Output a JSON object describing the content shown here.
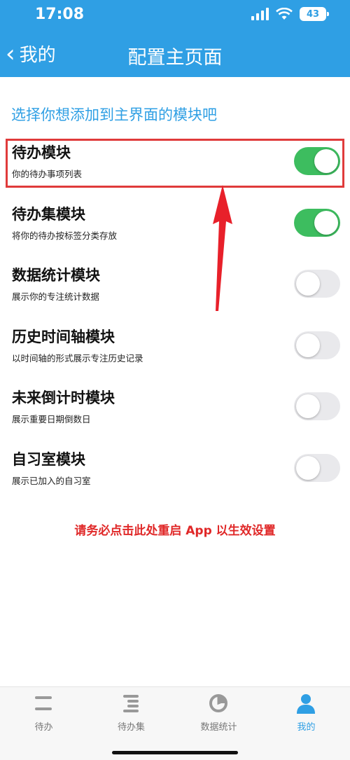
{
  "status_bar": {
    "time": "17:08",
    "battery": "43"
  },
  "nav": {
    "back_label": "我的",
    "title": "配置主页面"
  },
  "section_title": "选择你想添加到主界面的模块吧",
  "modules": [
    {
      "title": "待办模块",
      "subtitle": "你的待办事项列表",
      "enabled": true
    },
    {
      "title": "待办集模块",
      "subtitle": "将你的待办按标签分类存放",
      "enabled": true
    },
    {
      "title": "数据统计模块",
      "subtitle": "展示你的专注统计数据",
      "enabled": false
    },
    {
      "title": "历史时间轴模块",
      "subtitle": "以时间轴的形式展示专注历史记录",
      "enabled": false
    },
    {
      "title": "未来倒计时模块",
      "subtitle": "展示重要日期倒数日",
      "enabled": false
    },
    {
      "title": "自习室模块",
      "subtitle": "展示已加入的自习室",
      "enabled": false
    }
  ],
  "notice": "请务必点击此处重启 App 以生效设置",
  "tabs": [
    {
      "label": "待办",
      "icon": "todo-icon"
    },
    {
      "label": "待办集",
      "icon": "todo-set-icon"
    },
    {
      "label": "数据统计",
      "icon": "pie-chart-icon"
    },
    {
      "label": "我的",
      "icon": "person-icon"
    }
  ],
  "colors": {
    "header": "#2f9fe4",
    "toggle_on": "#3dbd5f",
    "accent_red": "#e02828"
  }
}
